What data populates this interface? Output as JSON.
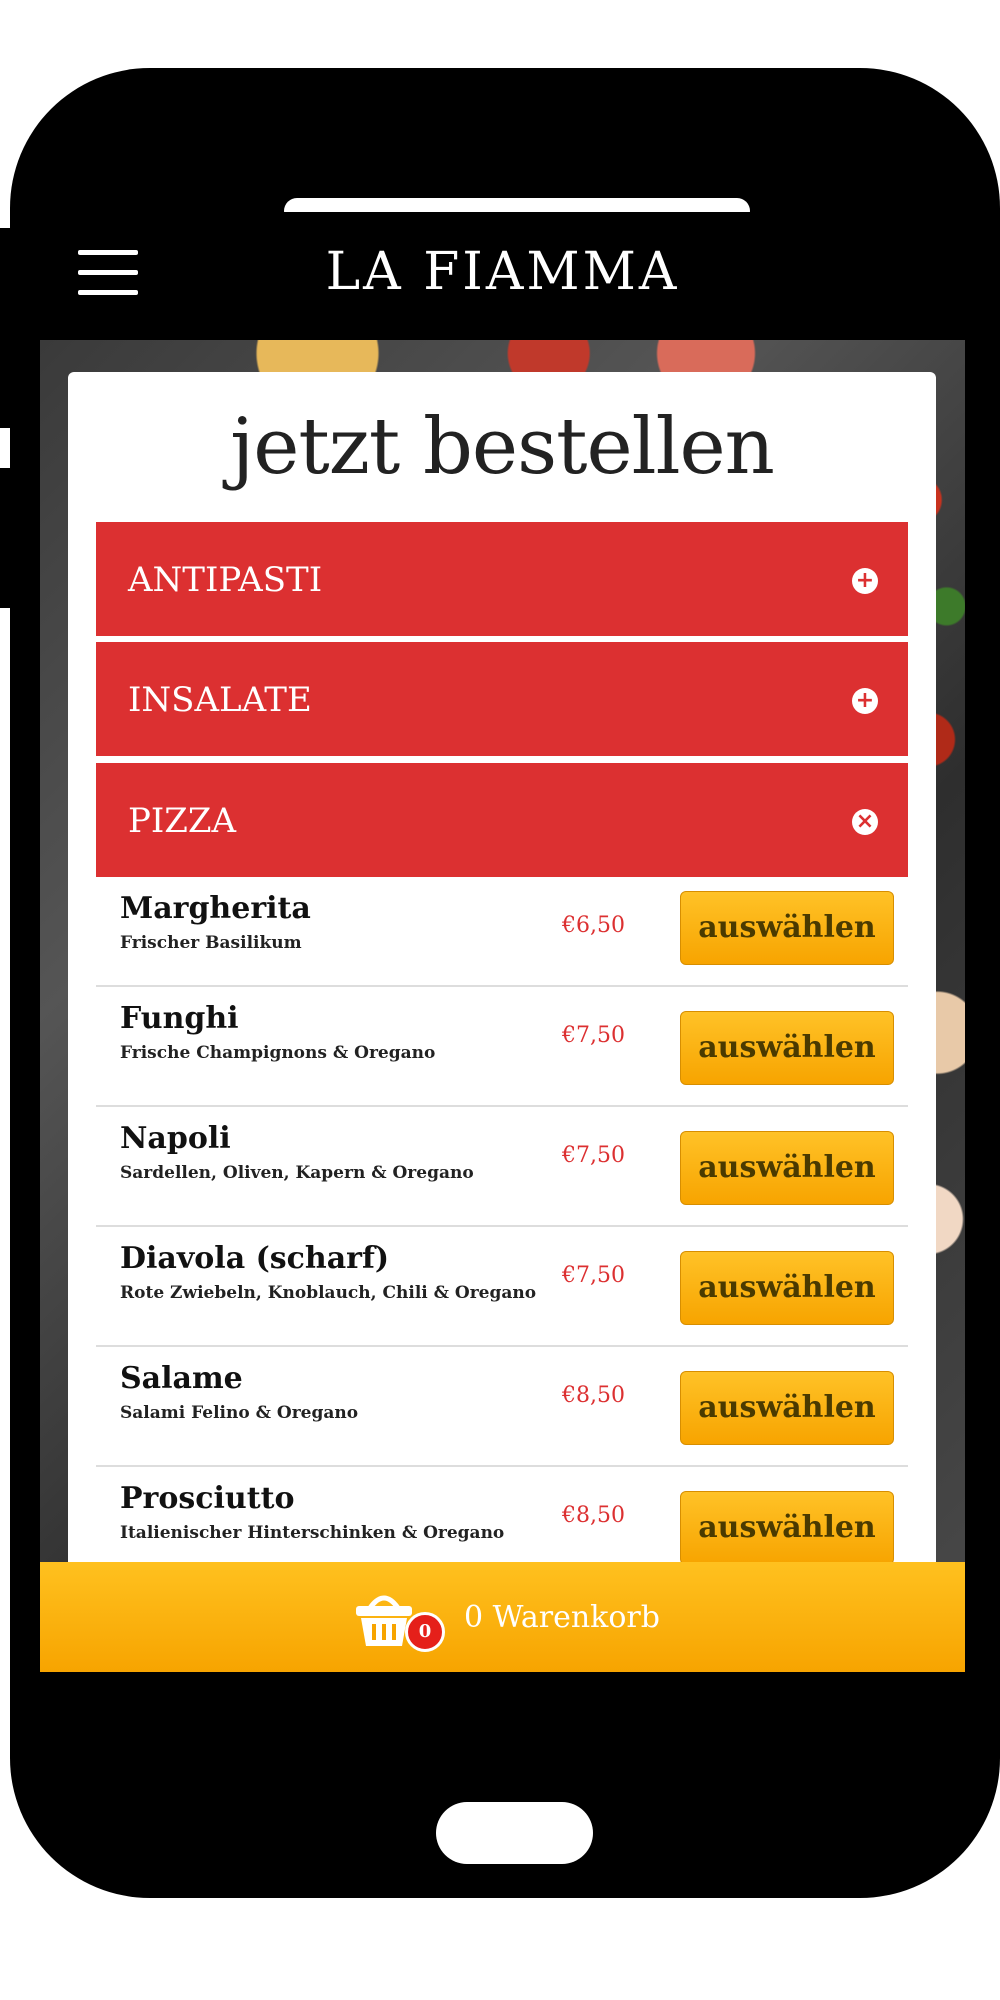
{
  "app": {
    "brand": "LA FIAMMA"
  },
  "header": {
    "menu_icon": "hamburger-menu-icon"
  },
  "order": {
    "title": "jetzt bestellen",
    "categories": [
      {
        "label": "ANTIPASTI",
        "state": "collapsed",
        "icon": "plus-circle-icon",
        "symbol": "+"
      },
      {
        "label": "INSALATE",
        "state": "collapsed",
        "icon": "plus-circle-icon",
        "symbol": "+"
      },
      {
        "label": "PIZZA",
        "state": "expanded",
        "icon": "close-circle-icon",
        "symbol": "×"
      }
    ],
    "items": [
      {
        "name": "Margherita",
        "description": "Frischer Basilikum",
        "price": "€6,50",
        "button": "auswählen"
      },
      {
        "name": "Funghi",
        "description": "Frische Champignons & Oregano",
        "price": "€7,50",
        "button": "auswählen"
      },
      {
        "name": "Napoli",
        "description": "Sardellen, Oliven, Kapern & Oregano",
        "price": "€7,50",
        "button": "auswählen"
      },
      {
        "name": "Diavola (scharf)",
        "description": "Rote Zwiebeln, Knoblauch, Chili & Oregano",
        "price": "€7,50",
        "button": "auswählen"
      },
      {
        "name": "Salame",
        "description": "Salami Felino & Oregano",
        "price": "€8,50",
        "button": "auswählen"
      },
      {
        "name": "Prosciutto",
        "description": "Italienischer Hinterschinken & Oregano",
        "price": "€8,50",
        "button": "auswählen"
      }
    ]
  },
  "cart": {
    "count": "0",
    "label": "0 Warenkorb",
    "icon": "basket-icon"
  },
  "colors": {
    "accent_red": "#dc3031",
    "button_yellow": "#ffc227",
    "button_orange": "#f7a400",
    "badge_red": "#e5201a"
  }
}
